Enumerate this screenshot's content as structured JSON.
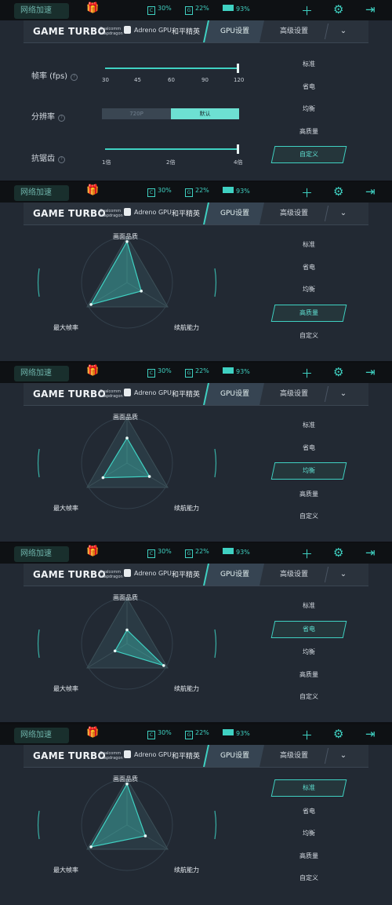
{
  "colors": {
    "accent": "#3fd1c2",
    "panel_bg": "#222933",
    "header_bg": "#2a323c",
    "text": "#d6dce3"
  },
  "status_bar": {
    "net_button": "网络加速",
    "cpu": "30%",
    "gpu": "22%",
    "battery": "93%",
    "icons": [
      "gift-icon",
      "plus-icon",
      "robot-icon",
      "exit-icon"
    ]
  },
  "header": {
    "brand": "GAME TURBO",
    "chip_brand": "Qualcomm snapdragon",
    "gpu": "Adreno GPU",
    "game": "和平精英",
    "tab_gpu": "GPU设置",
    "tab_advanced": "高级设置"
  },
  "presets": [
    "标准",
    "省电",
    "均衡",
    "高质量",
    "自定义"
  ],
  "custom_panel": {
    "fps_label": "帧率 (fps)",
    "fps_ticks": [
      "30",
      "45",
      "60",
      "90",
      "120"
    ],
    "fps_value": "120",
    "resolution_label": "分辨率",
    "resolution_options": [
      "720P",
      "默认"
    ],
    "resolution_selected": "默认",
    "aa_label": "抗锯齿",
    "aa_ticks": [
      "1倍",
      "2倍",
      "4倍"
    ],
    "aa_value": "4倍",
    "selected_preset": "自定义"
  },
  "radar": {
    "axis_top": "画面品质",
    "axis_left": "最大帧率",
    "axis_right": "续航能力"
  },
  "panels": [
    {
      "selected_preset": "高质量",
      "quality": 0.9,
      "fps": 0.9,
      "battery": 0.35
    },
    {
      "selected_preset": "均衡",
      "quality": 0.55,
      "fps": 0.6,
      "battery": 0.55
    },
    {
      "selected_preset": "省电",
      "quality": 0.3,
      "fps": 0.3,
      "battery": 0.9
    },
    {
      "selected_preset": "标准",
      "quality": 0.9,
      "fps": 0.9,
      "battery": 0.45
    }
  ]
}
